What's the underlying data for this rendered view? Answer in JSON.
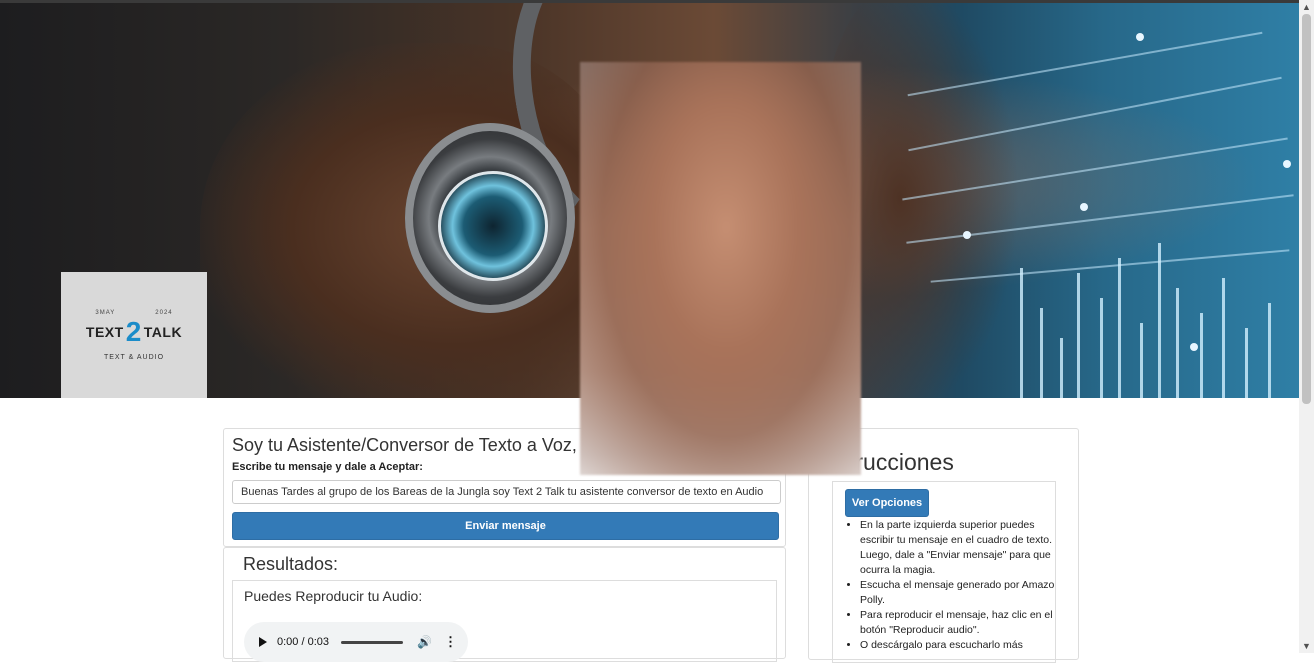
{
  "hero": {
    "logo": {
      "left_text": "3MAY",
      "right_text": "2024",
      "word1": "TEXT",
      "number": "2",
      "word2": "TALK",
      "subtitle": "TEXT & AUDIO"
    }
  },
  "assistant": {
    "title": "Soy tu Asistente/Conversor de Texto a Voz,",
    "label": "Escribe tu mensaje y dale a Aceptar:",
    "input_value": "Buenas Tardes al grupo de los Bareas de la Jungla soy Text 2 Talk tu asistente conversor de texto en Audio",
    "send_label": "Enviar mensaje"
  },
  "results": {
    "title": "Resultados:",
    "audio_label": "Puedes Reproducir tu Audio:",
    "player_time": "0:00 / 0:03"
  },
  "instructions": {
    "title": "trucciones",
    "options_label": "Ver Opciones",
    "items": [
      "En la parte izquierda superior puedes escribir tu mensaje en el cuadro de texto. Luego, dale a \"Enviar mensaje\" para que ocurra la magia.",
      "Escucha el mensaje generado por Amazon Polly.",
      "Para reproducir el mensaje, haz clic en el botón \"Reproducir audio\".",
      "O descárgalo para escucharlo más"
    ]
  },
  "colors": {
    "primary": "#337ab7",
    "logo_accent": "#1b8cc9"
  },
  "icons": [
    "play-icon",
    "volume-icon",
    "more-options-icon",
    "scroll-up-icon",
    "scroll-down-icon"
  ]
}
